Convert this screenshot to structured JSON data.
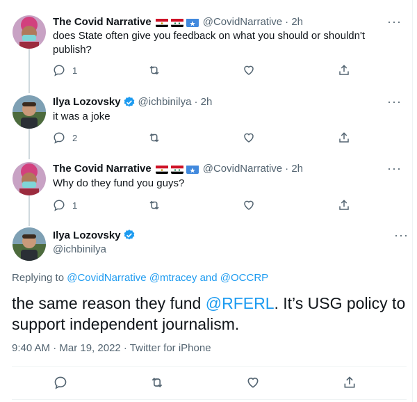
{
  "colors": {
    "accent": "#1d9bf0",
    "secondary_text": "#536471",
    "verified": "#1d9bf0"
  },
  "replies": [
    {
      "name": "The Covid Narrative",
      "flags": [
        "egypt-flag-icon",
        "syria-flag-icon",
        "somalia-flag-icon"
      ],
      "handle": "@CovidNarrative",
      "time": "· 2h",
      "text": "does State often give you feedback on what you should or shouldn't publish?",
      "reply_count": "1"
    },
    {
      "name": "Ilya Lozovsky",
      "verified": true,
      "handle": "@ichbinilya",
      "time": "· 2h",
      "text": "it was a joke",
      "reply_count": "2"
    },
    {
      "name": "The Covid Narrative",
      "flags": [
        "egypt-flag-icon",
        "syria-flag-icon",
        "somalia-flag-icon"
      ],
      "handle": "@CovidNarrative",
      "time": "· 2h",
      "text": "Why do they fund you guys?",
      "reply_count": "1"
    }
  ],
  "main_tweet": {
    "name": "Ilya Lozovsky",
    "handle": "@ichbinilya",
    "replying_prefix": "Replying to",
    "replying_to_1": "@CovidNarrative",
    "replying_to_2": "@mtracey",
    "replying_and": "and",
    "replying_to_3": "@OCCRP",
    "text_before": "the same reason they fund ",
    "text_link": "@RFERL",
    "text_after": ". It’s USG policy to support independent journalism.",
    "time": "9:40 AM · Mar 19, 2022 · Twitter for iPhone"
  },
  "more_label": "···"
}
